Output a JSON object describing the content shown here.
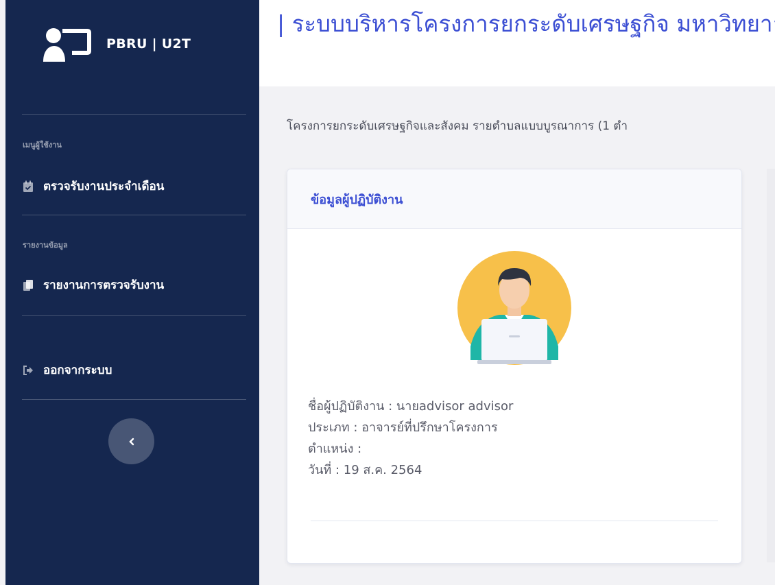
{
  "brand": {
    "icon": "user-monitor-icon",
    "name": "PBRU | U2T"
  },
  "sidebar": {
    "sections": [
      {
        "heading": "เมนูผู้ใช้งาน",
        "items": [
          {
            "label": "ตรวจรับงานประจำเดือน",
            "icon": "calendar-check-icon"
          }
        ]
      },
      {
        "heading": "รายงานข้อมูล",
        "items": [
          {
            "label": "รายงานการตรวจรับงาน",
            "icon": "copy-icon"
          }
        ]
      }
    ],
    "logout": {
      "label": "ออกจากระบบ",
      "icon": "sign-out-icon"
    },
    "toggle": {
      "icon": "chevron-left-icon"
    }
  },
  "header": {
    "title": "| ระบบบริหารโครงการยกระดับเศรษฐกิจ มหาวิทยาลัย)"
  },
  "main": {
    "subtitle": "โครงการยกระดับเศรษฐกิจและสังคม รายตำบลแบบบูรณาการ (1 ตำ",
    "card": {
      "title": "ข้อมูลผู้ปฏิบัติงาน",
      "avatar": "user-laptop-avatar",
      "info": [
        "ชื่อผู้ปฏิบัติงาน : นายadvisor advisor",
        "ประเภท : อาจารย์ที่ปรึกษาโครงการ",
        "ตำแหน่ง :",
        "วันที่ : 19 ส.ค. 2564"
      ]
    }
  },
  "colors": {
    "sidebar_bg": "#15274f",
    "accent": "#3c4fd3",
    "avatar_circle": "#f7c04a"
  }
}
